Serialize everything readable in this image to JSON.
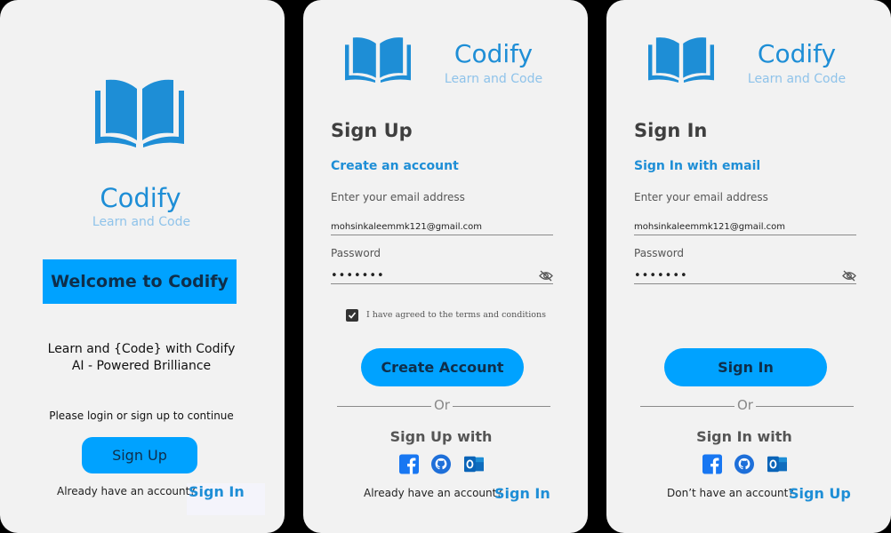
{
  "colors": {
    "accent": "#00a2ff",
    "brand": "#1e8ed6",
    "panel_bg": "#f2f2f2"
  },
  "welcome": {
    "brand": "Codify",
    "tagline": "Learn and Code",
    "banner": "Welcome to Codify",
    "desc_line1": "Learn and {Code} with Codify",
    "desc_line2": "AI - Powered Brilliance",
    "prompt": "Please login or sign up to continue",
    "signup_button": "Sign Up",
    "footer_text": "Already have an account?",
    "footer_link": "Sign In"
  },
  "signup": {
    "brand": "Codify",
    "tagline": "Learn and Code",
    "title": "Sign Up",
    "subtitle": "Create an account",
    "email_label": "Enter your email address",
    "email_value": "mohsinkaleemmk121@gmail.com",
    "password_label": "Password",
    "password_value": "•••••••",
    "terms_checked": true,
    "terms_text": "I have agreed to the terms and conditions",
    "submit_button": "Create Account",
    "divider": "Or",
    "social_heading": "Sign Up with",
    "social_icons": [
      "facebook-icon",
      "github-icon",
      "outlook-icon"
    ],
    "footer_text": "Already have an account?",
    "footer_link": "Sign In"
  },
  "signin": {
    "brand": "Codify",
    "tagline": "Learn and Code",
    "title": "Sign In",
    "subtitle": "Sign In with email",
    "email_label": "Enter your email address",
    "email_value": "mohsinkaleemmk121@gmail.com",
    "password_label": "Password",
    "password_value": "•••••••",
    "submit_button": "Sign In",
    "divider": "Or",
    "social_heading": "Sign In with",
    "social_icons": [
      "facebook-icon",
      "github-icon",
      "outlook-icon"
    ],
    "footer_text": "Don’t have an account?",
    "footer_link": "Sign Up"
  }
}
